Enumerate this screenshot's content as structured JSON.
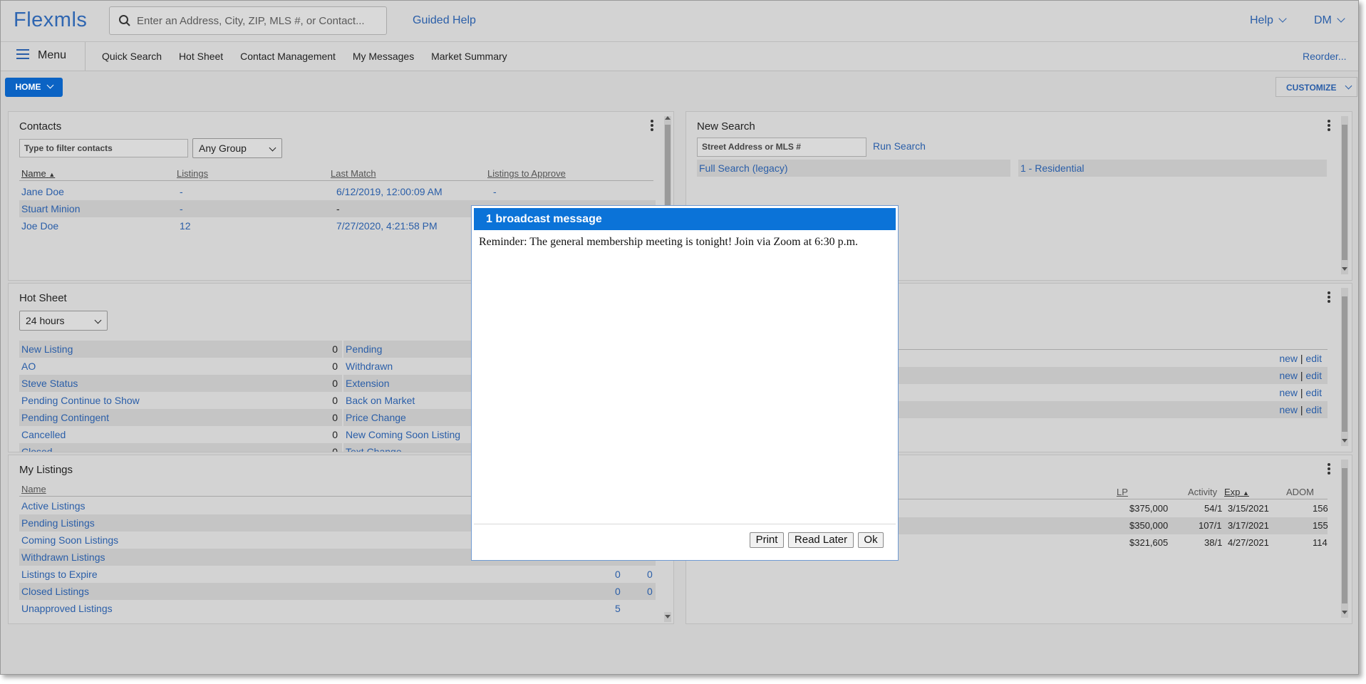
{
  "header": {
    "logo": "Flexmls",
    "search_placeholder": "Enter an Address, City, ZIP, MLS #, or Contact...",
    "guided_help": "Guided Help",
    "help": "Help",
    "user": "DM"
  },
  "nav": {
    "menu": "Menu",
    "items": [
      "Quick Search",
      "Hot Sheet",
      "Contact Management",
      "My Messages",
      "Market Summary"
    ],
    "reorder": "Reorder..."
  },
  "toolbar": {
    "home": "HOME",
    "customize": "CUSTOMIZE"
  },
  "contacts": {
    "title": "Contacts",
    "filter_placeholder": "Type to filter contacts",
    "group": "Any Group",
    "columns": [
      "Name",
      "Listings",
      "Last Match",
      "Listings to Approve"
    ],
    "rows": [
      {
        "name": "Jane Doe",
        "listings": "-",
        "last_match": "6/12/2019, 12:00:09 AM",
        "approve": "-"
      },
      {
        "name": "Stuart Minion",
        "listings": "-",
        "last_match": "-",
        "approve": ""
      },
      {
        "name": "Joe Doe",
        "listings": "12",
        "last_match": "7/27/2020, 4:21:58 PM",
        "approve": ""
      }
    ]
  },
  "hotsheet": {
    "title": "Hot Sheet",
    "period": "24 hours",
    "left": [
      {
        "label": "New Listing",
        "count": "0"
      },
      {
        "label": "AO",
        "count": "0"
      },
      {
        "label": "Steve Status",
        "count": "0"
      },
      {
        "label": "Pending Continue to Show",
        "count": "0"
      },
      {
        "label": "Pending Contingent",
        "count": "0"
      },
      {
        "label": "Cancelled",
        "count": "0"
      },
      {
        "label": "Closed",
        "count": "0"
      }
    ],
    "right": [
      "Pending",
      "Withdrawn",
      "Extension",
      "Back on Market",
      "Price Change",
      "New Coming Soon Listing",
      "Text Change"
    ]
  },
  "mylistings": {
    "title": "My Listings",
    "column": "Name",
    "rows": [
      {
        "name": "Active Listings",
        "a": "",
        "b": ""
      },
      {
        "name": "Pending Listings",
        "a": "",
        "b": ""
      },
      {
        "name": "Coming Soon Listings",
        "a": "",
        "b": ""
      },
      {
        "name": "Withdrawn Listings",
        "a": "",
        "b": ""
      },
      {
        "name": "Listings to Expire",
        "a": "0",
        "b": "0"
      },
      {
        "name": "Closed Listings",
        "a": "0",
        "b": "0"
      },
      {
        "name": "Unapproved Listings",
        "a": "5",
        "b": ""
      }
    ]
  },
  "newsearch": {
    "title": "New Search",
    "input_placeholder": "Street Address or MLS #",
    "run": "Run Search",
    "full": "Full Search (legacy)",
    "type": "1 - Residential"
  },
  "saved": {
    "new": "new",
    "sep": "|",
    "edit": "edit",
    "rows": 4
  },
  "expiring": {
    "columns": {
      "lp": "LP",
      "activity": "Activity",
      "exp": "Exp",
      "adom": "ADOM"
    },
    "rows": [
      {
        "lp": "$375,000",
        "activity": "54/1",
        "exp": "3/15/2021",
        "adom": "156"
      },
      {
        "lp": "$350,000",
        "activity": "107/1",
        "exp": "3/17/2021",
        "adom": "155"
      },
      {
        "lp": "$321,605",
        "activity": "38/1",
        "exp": "4/27/2021",
        "adom": "114"
      }
    ]
  },
  "modal": {
    "title": "1 broadcast message",
    "message": "Reminder: The general membership meeting is tonight! Join via Zoom at 6:30 p.m.",
    "print": "Print",
    "read_later": "Read Later",
    "ok": "Ok"
  }
}
